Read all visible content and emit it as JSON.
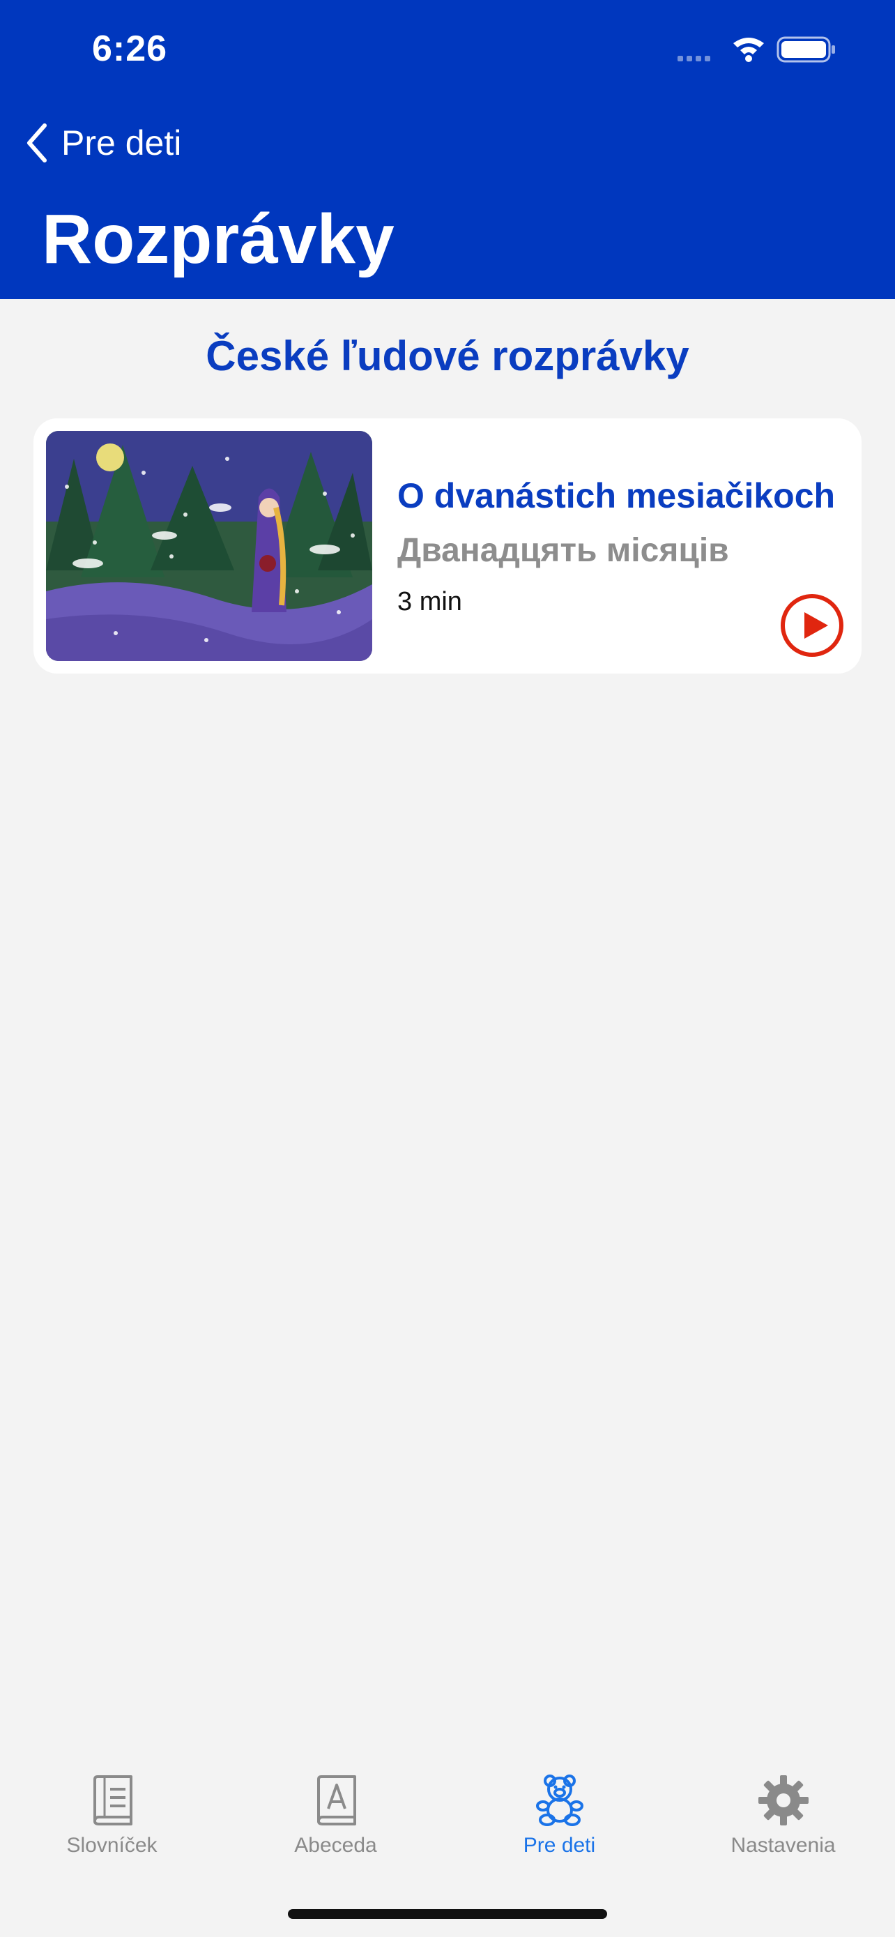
{
  "status_bar": {
    "time": "6:26"
  },
  "nav": {
    "back_label": "Pre deti",
    "title": "Rozprávky"
  },
  "section": {
    "title": "České ľudové rozprávky"
  },
  "story": {
    "title": "O dvanástich mesiačikoch",
    "subtitle": "Дванадцять місяців",
    "duration": "3 min",
    "play_icon": "play-circle-icon"
  },
  "tabs": [
    {
      "label": "Slovníček",
      "icon": "book-icon",
      "active": false
    },
    {
      "label": "Abeceda",
      "icon": "alphabet-book-icon",
      "active": false
    },
    {
      "label": "Pre deti",
      "icon": "teddy-bear-icon",
      "active": true
    },
    {
      "label": "Nastavenia",
      "icon": "gear-icon",
      "active": false
    }
  ],
  "colors": {
    "header": "#0037be",
    "accent": "#0a3dc0",
    "play": "#e0260f",
    "tab_active": "#1a73e8",
    "tab_inactive": "#8a8a8a"
  }
}
